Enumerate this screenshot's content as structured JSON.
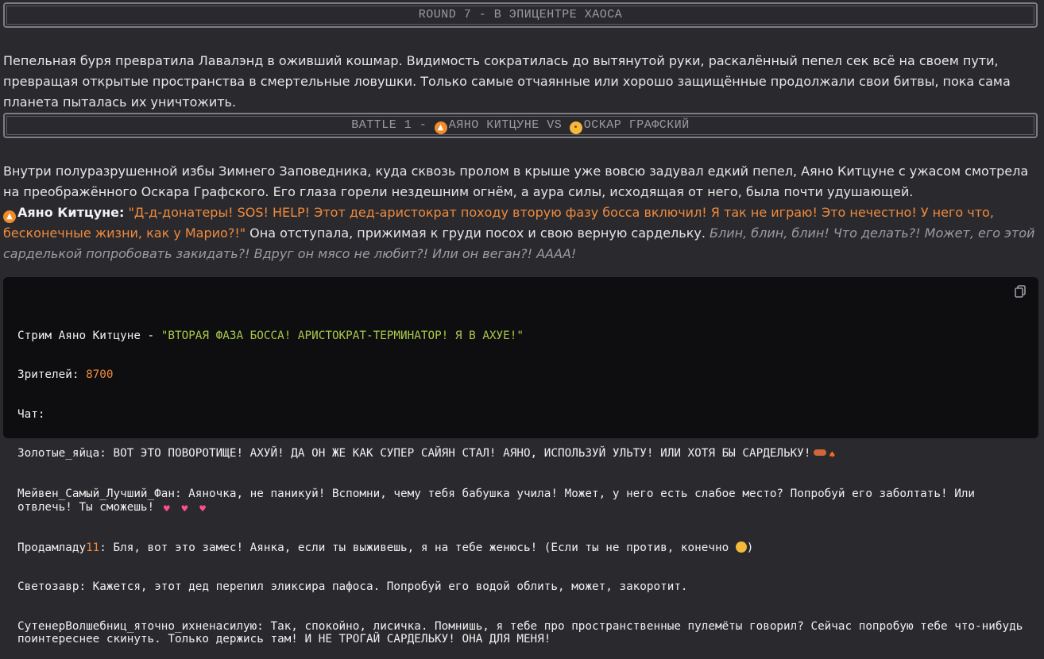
{
  "round_banner": "ROUND 7 - В ЭПИЦЕНТРЕ ХАОСА",
  "intro": "Пепельная буря превратила Лавалэнд в оживший кошмар. Видимость сократилась до вытянутой руки, раскалённый пепел сек всё на своем пути, превращая открытые пространства в смертельные ловушки. Только самые отчаянные или хорошо защищённые продолжали свои битвы, пока сама планета пыталась их уничтожить.",
  "battle_banner": {
    "prefix": "BATTLE 1 - ",
    "fighter_a": "АЯНО КИТЦУНЕ",
    "vs": " VS ",
    "fighter_b": "ОСКАР ГРАФСКИЙ"
  },
  "narration": "Внутри полуразрушенной избы Зимнего Заповедника, куда сквозь пролом в крыше уже вовсю задувал едкий пепел, Аяно Китцуне с ужасом смотрела на преображённого Оскара Графского. Его глаза горели нездешним огнём, а аура силы, исходящая от него, была почти удушающей.",
  "dialogue": {
    "speaker": "Аяно Китцуне:",
    "quote": "\"Д-д-донатеры! SOS! HELP! Этот дед-аристократ походу вторую фазу босса включил! Я так не играю! Это нечестно! У него что, бесконечные жизни, как у Марио?!\"",
    "action": " Она отступала, прижимая к груди посох и свою верную сардельку. ",
    "thought": "Блин, блин, блин! Что делать?! Может, его этой сарделькой попробовать закидать?! Вдруг он мясо не любит?! Или он веган?! АААА!"
  },
  "stream": {
    "title_prefix": "Стрим Аяно Китцуне - ",
    "title": "\"ВТОРАЯ ФАЗА БОССА! АРИСТОКРАТ-ТЕРМИНАТОР! Я В АХУЕ!\"",
    "viewers_label": "Зрителей: ",
    "viewers": "8700",
    "chat_label": "Чат:",
    "messages": [
      {
        "text": "Золотые_яйца: ВОТ ЭТО ПОВОРОТИЩЕ! АХУЙ! ДА ОН ЖЕ КАК СУПЕР САЙЯН СТАЛ! АЯНО, ИСПОЛЬЗУЙ УЛЬТУ! ИЛИ ХОТЯ БЫ САРДЕЛЬКУ!"
      },
      {
        "text": "Мейвен_Самый_Лучший_Фан: Аяночка, не паникуй! Вспомни, чему тебя бабушка учила! Может, у него есть слабое место? Попробуй его заболтать! Или отвлечь! Ты сможешь! "
      },
      {
        "name_prefix": "Продамладу",
        "name_number": "11",
        "text": ": Бля, вот это замес! Аянка, если ты выживешь, я на тебе женюсь! (Если ты не против, конечно ",
        "text_end": ")"
      },
      {
        "text": "Светозавр: Кажется, этот дед перепил эликсира пафоса. Попробуй его водой облить, может, закоротит."
      },
      {
        "text": "СутенерВолшебниц_яточно_ихненасилую: Так, спокойно, лисичка. Помнишь, я тебе про пространственные пулемёты говорил? Сейчас попробую тебе что-нибудь поинтереснее скинуть. Только держись там! И НЕ ТРОГАЙ САРДЕЛЬКУ! ОНА ДЛЯ МЕНЯ!"
      }
    ]
  },
  "icons": {
    "fox": "fox-emoji",
    "face": "pleading-face-emoji",
    "heart": "heart-emoji",
    "sausage": "hotdog-emoji",
    "fire": "fire-emoji",
    "copy": "copy-icon"
  },
  "colors": {
    "quote": "#f08a3c",
    "title_green": "#a8c84a",
    "number_orange": "#f08a3c",
    "thought": "#9b9ba3"
  }
}
